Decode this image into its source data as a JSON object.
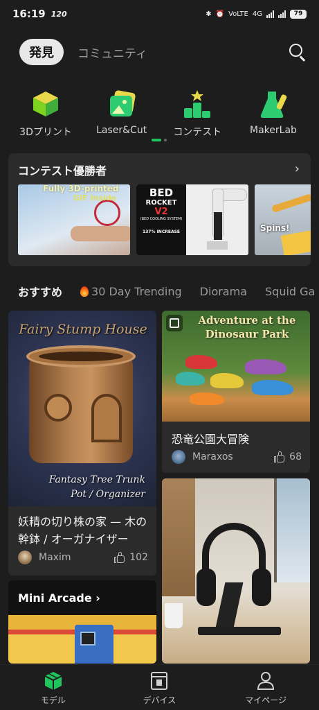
{
  "status_bar": {
    "time": "16:19",
    "fps": "120",
    "network": "VoLTE",
    "network_type": "4G",
    "battery": "79"
  },
  "header": {
    "active_tab": "発見",
    "other_tab": "コミュニティ",
    "search_icon": "search-icon"
  },
  "categories": [
    {
      "label": "3Dプリント",
      "icon": "cube-icon",
      "color": "#7ed321"
    },
    {
      "label": "Laser&Cut",
      "icon": "laser-image-icon",
      "color": "#2ecc71"
    },
    {
      "label": "コンテスト",
      "icon": "podium-icon",
      "color": "#2ecc71"
    },
    {
      "label": "MakerLab",
      "icon": "flask-icon",
      "color": "#2ecc71"
    }
  ],
  "contest": {
    "title": "コンテスト優勝者",
    "thumbs": [
      {
        "caption": "Fully 3D-printed",
        "caption2": "GIF Inside"
      },
      {
        "line1": "BED",
        "line2": "ROCKET",
        "line3": "V2",
        "line4": "(BED COOLING SYSTEM)",
        "line5": "137% INCREASE"
      },
      {
        "caption": "Spins!"
      }
    ]
  },
  "rec_tabs": {
    "active": "おすすめ",
    "items": [
      "30 Day Trending",
      "Diorama",
      "Squid Ga"
    ]
  },
  "feed": {
    "card1": {
      "image_title": "Fairy Stump House",
      "image_sub1": "Fantasy Tree Trunk",
      "image_sub2": "Pot / Organizer",
      "title": "妖精の切り株の家 — 木の幹鉢 / オーガナイザー",
      "author": "Maxim",
      "likes": "102"
    },
    "card2": {
      "image_title": "Adventure at the Dinosaur Park",
      "title": "恐竜公園大冒険",
      "author": "Maraxos",
      "likes": "68"
    },
    "card3": {
      "banner": "Mini Arcade",
      "chevron": "›"
    }
  },
  "bottom_nav": [
    {
      "label": "モデル",
      "icon": "model-cube-icon",
      "active": true
    },
    {
      "label": "デバイス",
      "icon": "printer-icon",
      "active": false
    },
    {
      "label": "マイページ",
      "icon": "profile-icon",
      "active": false
    }
  ],
  "colors": {
    "accent": "#1fc45c",
    "background": "#1d1d1d",
    "card": "#2b2b2b"
  }
}
